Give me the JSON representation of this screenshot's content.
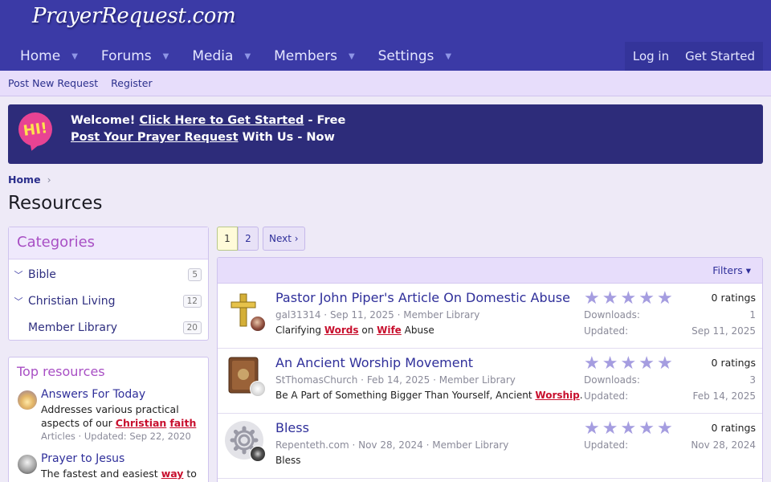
{
  "site": {
    "logo": "PrayerRequest.com"
  },
  "nav": {
    "items": [
      "Home",
      "Forums",
      "Media",
      "Members",
      "Settings"
    ],
    "login": "Log in",
    "get_started": "Get Started"
  },
  "subnav": {
    "items": [
      "Post New Request",
      "Register"
    ]
  },
  "notice": {
    "badge": "HI!",
    "line1_a": "Welcome! ",
    "line1_link": "Click Here to Get Started",
    "line1_b": " - Free",
    "line2_link": "Post Your Prayer Request",
    "line2_b": " With Us - Now"
  },
  "breadcrumb": {
    "home": "Home",
    "sep": "›"
  },
  "page": {
    "title": "Resources"
  },
  "categories": {
    "title": "Categories",
    "items": [
      {
        "label": "Bible",
        "count": "5"
      },
      {
        "label": "Christian Living",
        "count": "12"
      },
      {
        "label": "Member Library",
        "count": "20"
      }
    ]
  },
  "top_resources": {
    "title": "Top resources",
    "items": [
      {
        "title": "Answers For Today",
        "desc_a": "Addresses various practical aspects of our ",
        "desc_red1": "Christian",
        "desc_space": " ",
        "desc_red2": "faith",
        "meta": "Articles · Updated: Sep 22, 2020"
      },
      {
        "title": "Prayer to Jesus",
        "desc_a": "The fastest and easiest ",
        "desc_red1": "way",
        "desc_b": " to"
      }
    ]
  },
  "pagination": {
    "page1": "1",
    "page2": "2",
    "next": "Next ›"
  },
  "list": {
    "filters": "Filters ▾"
  },
  "resources": [
    {
      "title": "Pastor John Piper's Article On Domestic Abuse",
      "author": "gal31314",
      "date": "Sep 11, 2025",
      "category": "Member Library",
      "tag_a": "Clarifying ",
      "tag_red1": "Words",
      "tag_b": " on ",
      "tag_red2": "Wife",
      "tag_c": " Abuse",
      "ratings": "0 ratings",
      "downloads_label": "Downloads:",
      "downloads": "1",
      "updated_label": "Updated:",
      "updated": "Sep 11, 2025"
    },
    {
      "title": "An Ancient Worship Movement",
      "author": "StThomasChurch",
      "date": "Feb 14, 2025",
      "category": "Member Library",
      "tag_a": "Be A Part of Something Bigger Than Yourself, Ancient ",
      "tag_red1": "Worship",
      "tag_b": ".",
      "ratings": "0 ratings",
      "downloads_label": "Downloads:",
      "downloads": "3",
      "updated_label": "Updated:",
      "updated": "Feb 14, 2025"
    },
    {
      "title": "Bless",
      "author": "Repenteth.com",
      "date": "Nov 28, 2024",
      "category": "Member Library",
      "tag_a": "Bless",
      "ratings": "0 ratings",
      "updated_label": "Updated:",
      "updated": "Nov 28, 2024"
    }
  ],
  "meta_sep": " · ",
  "colors": {
    "header": "#3b3aa6",
    "accent": "#a84fc4",
    "link": "#2f2f9a",
    "keyword": "#c8102e"
  }
}
